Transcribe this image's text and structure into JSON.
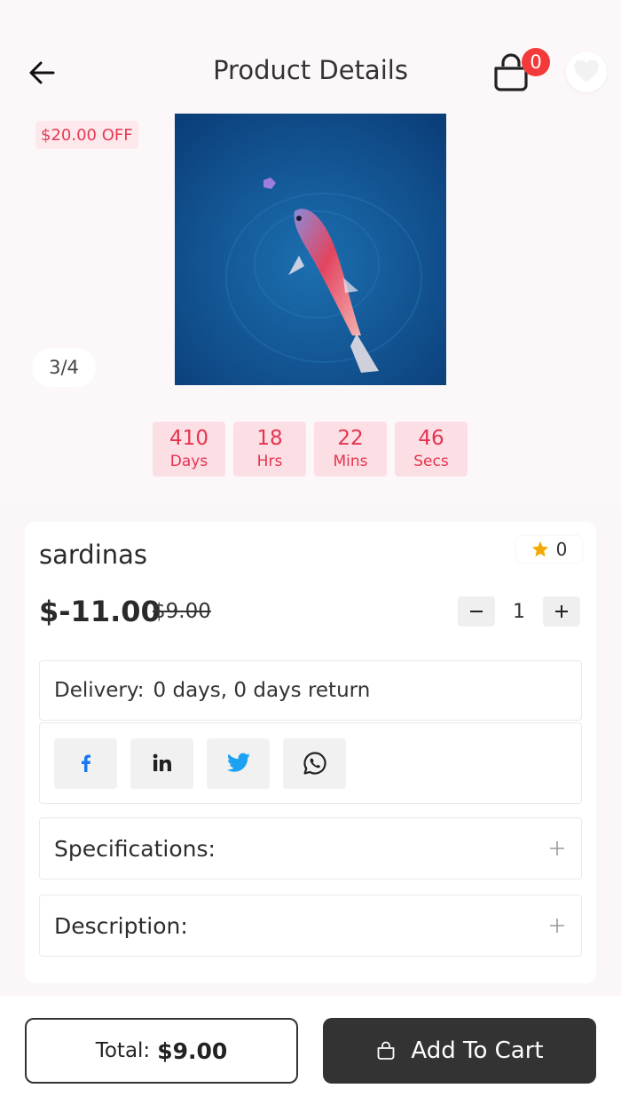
{
  "header": {
    "title": "Product Details",
    "cart_count": "0"
  },
  "product": {
    "discount_badge": "$20.00 OFF",
    "image_counter": "3/4",
    "name": "sardinas",
    "rating": "0",
    "price": "$-11.00",
    "old_price": "$9.00",
    "quantity": "1"
  },
  "countdown": [
    {
      "value": "410",
      "unit": "Days"
    },
    {
      "value": "18",
      "unit": "Hrs"
    },
    {
      "value": "22",
      "unit": "Mins"
    },
    {
      "value": "46",
      "unit": "Secs"
    }
  ],
  "delivery": {
    "label": "Delivery:",
    "value": "0 days, 0 days return"
  },
  "share": [
    {
      "icon": "facebook-icon"
    },
    {
      "icon": "linkedin-icon"
    },
    {
      "icon": "twitter-icon"
    },
    {
      "icon": "whatsapp-icon"
    }
  ],
  "sections": {
    "specifications": "Specifications:",
    "description": "Description:"
  },
  "bottom": {
    "total_label": "Total:",
    "total_value": "$9.00",
    "add_to_cart": "Add To Cart"
  },
  "colors": {
    "accent_red": "#e6334f",
    "badge_red": "#f23a3a",
    "dark": "#333333",
    "facebook": "#1877f2",
    "twitter": "#1da1f2"
  }
}
